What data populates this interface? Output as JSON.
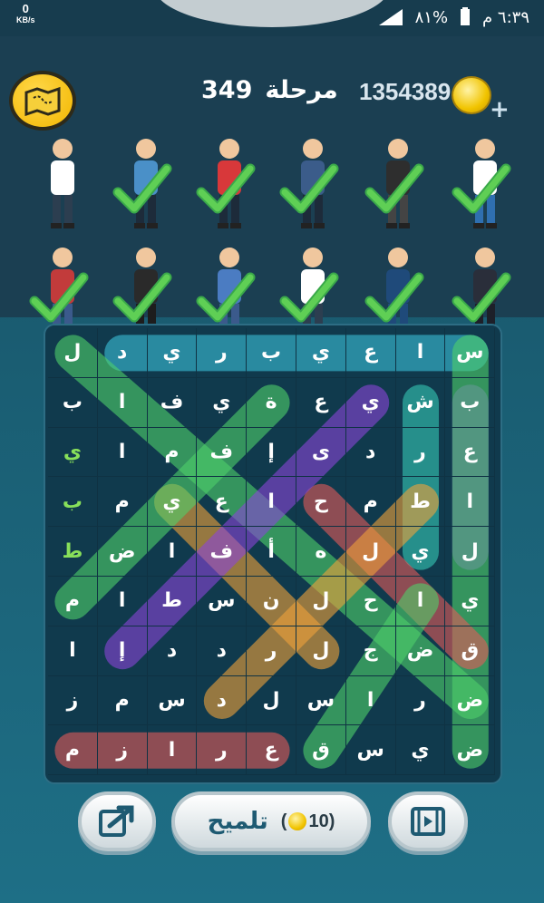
{
  "status": {
    "kb_value": "0",
    "kb_unit": "KB/s",
    "battery": "٨١%",
    "time": "٦:٣٩ م"
  },
  "header": {
    "stage_label": "مرحلة",
    "stage_number": "349",
    "coins": "1354389",
    "plus": "+"
  },
  "icons": {
    "map": "treasure-map-icon",
    "coin": "coin-icon",
    "share": "share-icon",
    "video": "video-icon",
    "check": "checkmark-icon"
  },
  "professions": [
    {
      "id": "doctor",
      "found": false
    },
    {
      "id": "police-officer",
      "found": true
    },
    {
      "id": "firefighter",
      "found": true
    },
    {
      "id": "mail-carrier",
      "found": true
    },
    {
      "id": "chef",
      "found": true
    },
    {
      "id": "footballer",
      "found": true
    },
    {
      "id": "farmer",
      "found": true
    },
    {
      "id": "judge",
      "found": true
    },
    {
      "id": "construction-worker",
      "found": true
    },
    {
      "id": "flight-attendant",
      "found": true
    },
    {
      "id": "pilot",
      "found": true
    },
    {
      "id": "businessman",
      "found": true
    }
  ],
  "grid": [
    [
      "ل",
      "د",
      "ي",
      "ر",
      "ب",
      "ي",
      "ع",
      "ا",
      "س"
    ],
    [
      "ب",
      "ا",
      "ف",
      "ي",
      "ة",
      "ع",
      "ي",
      "ش",
      "ب"
    ],
    [
      "ي",
      "ا",
      "م",
      "ف",
      "إ",
      "ى",
      "د",
      "ر",
      "ع"
    ],
    [
      "ب",
      "م",
      "ي",
      "ع",
      "ا",
      "ح",
      "م",
      "ط",
      "ا"
    ],
    [
      "ط",
      "ض",
      "ا",
      "ف",
      "أ",
      "ه",
      "ل",
      "ي",
      "ل"
    ],
    [
      "م",
      "ا",
      "ط",
      "س",
      "ن",
      "ل",
      "ح",
      "ا",
      "ي"
    ],
    [
      "ا",
      "إ",
      "د",
      "د",
      "ر",
      "ل",
      "ج",
      "ض",
      "ق"
    ],
    [
      "ز",
      "م",
      "س",
      "د",
      "ل",
      "س",
      "ا",
      "ر",
      "ض"
    ],
    [
      "م",
      "ز",
      "ا",
      "ر",
      "ع",
      "ق",
      "س",
      "ي",
      "ض"
    ]
  ],
  "green_cells": [
    "2,0",
    "3,0",
    "4,0"
  ],
  "buttons": {
    "hint_label": "تلميح",
    "hint_cost": "10",
    "hint_open": "(",
    "hint_close": ")"
  },
  "colors": {
    "cyan": "#3bc0d8",
    "purple": "#8a44d8",
    "green": "#4fd06a",
    "orange": "#f0a23a",
    "red": "#e25a5a",
    "teal": "#36c8b6"
  }
}
